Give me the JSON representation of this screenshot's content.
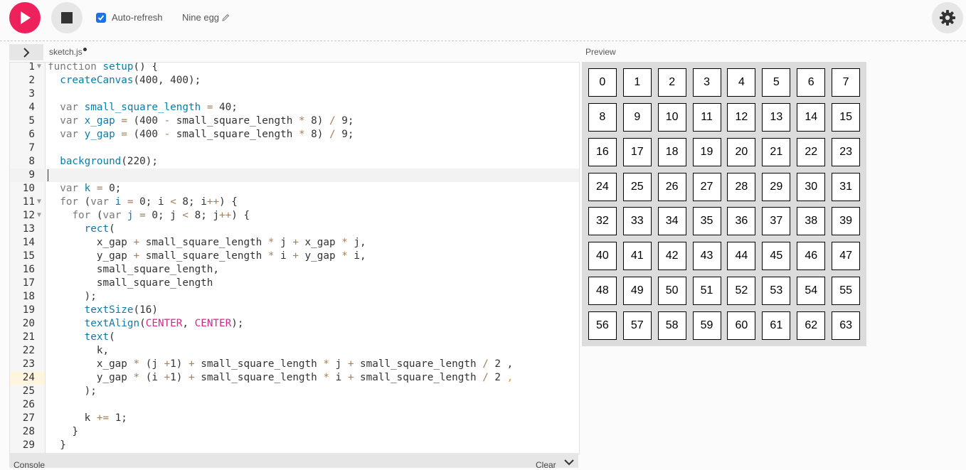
{
  "toolbar": {
    "play_icon": "play-icon",
    "stop_icon": "stop-icon",
    "auto_refresh_label": "Auto-refresh",
    "auto_refresh_checked": true,
    "project_name": "Nine egg",
    "edit_icon": "pencil-icon",
    "settings_icon": "gear-icon",
    "accent_color": "#ed225d"
  },
  "editor": {
    "file_name": "sketch.js",
    "unsaved": true,
    "active_line": 9,
    "lines": [
      {
        "n": "1",
        "fold": true,
        "tokens": [
          [
            "kw",
            "function"
          ],
          [
            "t",
            " "
          ],
          [
            "fn",
            "setup"
          ],
          [
            "t",
            "() {"
          ]
        ]
      },
      {
        "n": "2",
        "tokens": [
          [
            "t",
            "  "
          ],
          [
            "fn",
            "createCanvas"
          ],
          [
            "t",
            "(400, 400);"
          ]
        ]
      },
      {
        "n": "3",
        "tokens": []
      },
      {
        "n": "4",
        "tokens": [
          [
            "t",
            "  "
          ],
          [
            "kw",
            "var"
          ],
          [
            "t",
            " "
          ],
          [
            "def",
            "small_square_length"
          ],
          [
            "t",
            " "
          ],
          [
            "op",
            "="
          ],
          [
            "t",
            " 40;"
          ]
        ]
      },
      {
        "n": "5",
        "tokens": [
          [
            "t",
            "  "
          ],
          [
            "kw",
            "var"
          ],
          [
            "t",
            " "
          ],
          [
            "def",
            "x_gap"
          ],
          [
            "t",
            " "
          ],
          [
            "op",
            "="
          ],
          [
            "t",
            " (400 "
          ],
          [
            "op",
            "-"
          ],
          [
            "t",
            " small_square_length "
          ],
          [
            "op",
            "*"
          ],
          [
            "t",
            " 8) "
          ],
          [
            "op",
            "/"
          ],
          [
            "t",
            " 9;"
          ]
        ]
      },
      {
        "n": "6",
        "tokens": [
          [
            "t",
            "  "
          ],
          [
            "kw",
            "var"
          ],
          [
            "t",
            " "
          ],
          [
            "def",
            "y_gap"
          ],
          [
            "t",
            " "
          ],
          [
            "op",
            "="
          ],
          [
            "t",
            " (400 "
          ],
          [
            "op",
            "-"
          ],
          [
            "t",
            " small_square_length "
          ],
          [
            "op",
            "*"
          ],
          [
            "t",
            " 8) "
          ],
          [
            "op",
            "/"
          ],
          [
            "t",
            " 9;"
          ]
        ]
      },
      {
        "n": "7",
        "tokens": []
      },
      {
        "n": "8",
        "tokens": [
          [
            "t",
            "  "
          ],
          [
            "fn",
            "background"
          ],
          [
            "t",
            "(220);"
          ]
        ]
      },
      {
        "n": "9",
        "tokens": []
      },
      {
        "n": "10",
        "tokens": [
          [
            "t",
            "  "
          ],
          [
            "kw",
            "var"
          ],
          [
            "t",
            " "
          ],
          [
            "def",
            "k"
          ],
          [
            "t",
            " "
          ],
          [
            "op",
            "="
          ],
          [
            "t",
            " 0;"
          ]
        ]
      },
      {
        "n": "11",
        "fold": true,
        "tokens": [
          [
            "t",
            "  "
          ],
          [
            "kw",
            "for"
          ],
          [
            "t",
            " ("
          ],
          [
            "kw",
            "var"
          ],
          [
            "t",
            " "
          ],
          [
            "def",
            "i"
          ],
          [
            "t",
            " "
          ],
          [
            "op",
            "="
          ],
          [
            "t",
            " 0; i "
          ],
          [
            "op",
            "<"
          ],
          [
            "t",
            " 8; i"
          ],
          [
            "op",
            "++"
          ],
          [
            "t",
            ") {"
          ]
        ]
      },
      {
        "n": "12",
        "fold": true,
        "tokens": [
          [
            "t",
            "    "
          ],
          [
            "kw",
            "for"
          ],
          [
            "t",
            " ("
          ],
          [
            "kw",
            "var"
          ],
          [
            "t",
            " "
          ],
          [
            "def",
            "j"
          ],
          [
            "t",
            " "
          ],
          [
            "op",
            "="
          ],
          [
            "t",
            " 0; j "
          ],
          [
            "op",
            "<"
          ],
          [
            "t",
            " 8; j"
          ],
          [
            "op",
            "++"
          ],
          [
            "t",
            ") {"
          ]
        ]
      },
      {
        "n": "13",
        "tokens": [
          [
            "t",
            "      "
          ],
          [
            "fn",
            "rect"
          ],
          [
            "t",
            "("
          ]
        ]
      },
      {
        "n": "14",
        "tokens": [
          [
            "t",
            "        x_gap "
          ],
          [
            "op",
            "+"
          ],
          [
            "t",
            " small_square_length "
          ],
          [
            "op",
            "*"
          ],
          [
            "t",
            " j "
          ],
          [
            "op",
            "+"
          ],
          [
            "t",
            " x_gap "
          ],
          [
            "op",
            "*"
          ],
          [
            "t",
            " j,"
          ]
        ]
      },
      {
        "n": "15",
        "tokens": [
          [
            "t",
            "        y_gap "
          ],
          [
            "op",
            "+"
          ],
          [
            "t",
            " small_square_length "
          ],
          [
            "op",
            "*"
          ],
          [
            "t",
            " i "
          ],
          [
            "op",
            "+"
          ],
          [
            "t",
            " y_gap "
          ],
          [
            "op",
            "*"
          ],
          [
            "t",
            " i,"
          ]
        ]
      },
      {
        "n": "16",
        "tokens": [
          [
            "t",
            "        small_square_length,"
          ]
        ]
      },
      {
        "n": "17",
        "tokens": [
          [
            "t",
            "        small_square_length"
          ]
        ]
      },
      {
        "n": "18",
        "tokens": [
          [
            "t",
            "      );"
          ]
        ]
      },
      {
        "n": "19",
        "tokens": [
          [
            "t",
            "      "
          ],
          [
            "fn",
            "textSize"
          ],
          [
            "t",
            "(16)"
          ]
        ]
      },
      {
        "n": "20",
        "tokens": [
          [
            "t",
            "      "
          ],
          [
            "fn",
            "textAlign"
          ],
          [
            "t",
            "("
          ],
          [
            "const",
            "CENTER"
          ],
          [
            "t",
            ", "
          ],
          [
            "const",
            "CENTER"
          ],
          [
            "t",
            ");"
          ]
        ]
      },
      {
        "n": "21",
        "tokens": [
          [
            "t",
            "      "
          ],
          [
            "fn",
            "text"
          ],
          [
            "t",
            "("
          ]
        ]
      },
      {
        "n": "22",
        "tokens": [
          [
            "t",
            "        k,"
          ]
        ]
      },
      {
        "n": "23",
        "tokens": [
          [
            "t",
            "        x_gap "
          ],
          [
            "op",
            "*"
          ],
          [
            "t",
            " (j "
          ],
          [
            "op",
            "+"
          ],
          [
            "t",
            "1) "
          ],
          [
            "op",
            "+"
          ],
          [
            "t",
            " small_square_length "
          ],
          [
            "op",
            "*"
          ],
          [
            "t",
            " j "
          ],
          [
            "op",
            "+"
          ],
          [
            "t",
            " small_square_length "
          ],
          [
            "op",
            "/"
          ],
          [
            "t",
            " 2 ,"
          ]
        ]
      },
      {
        "n": "24",
        "tokens": [
          [
            "t",
            "        y_gap "
          ],
          [
            "op",
            "*"
          ],
          [
            "t",
            " (i "
          ],
          [
            "op",
            "+"
          ],
          [
            "t",
            "1) "
          ],
          [
            "op",
            "+"
          ],
          [
            "t",
            " small_square_length "
          ],
          [
            "op",
            "*"
          ],
          [
            "t",
            " i "
          ],
          [
            "op",
            "+"
          ],
          [
            "t",
            " small_square_length "
          ],
          [
            "op",
            "/"
          ],
          [
            "t",
            " 2 "
          ],
          [
            "warn",
            ","
          ]
        ]
      },
      {
        "n": "25",
        "tokens": [
          [
            "t",
            "      );"
          ]
        ]
      },
      {
        "n": "26",
        "tokens": []
      },
      {
        "n": "27",
        "tokens": [
          [
            "t",
            "      k "
          ],
          [
            "op",
            "+="
          ],
          [
            "t",
            " 1;"
          ]
        ]
      },
      {
        "n": "28",
        "tokens": [
          [
            "t",
            "    }"
          ]
        ]
      },
      {
        "n": "29",
        "tokens": [
          [
            "t",
            "  }"
          ]
        ]
      }
    ],
    "colors": {
      "kw": "#7a7a7a",
      "fn": "#0b7ca9",
      "def": "#0b7ca9",
      "op": "#a67f59",
      "const": "#d52889",
      "t": "#333333",
      "warn": "#e09c2b"
    }
  },
  "console": {
    "title": "Console",
    "clear_label": "Clear",
    "chevron_icon": "chevron-down-icon"
  },
  "preview": {
    "label": "Preview",
    "rows": 8,
    "cols": 8,
    "cells": [
      "0",
      "1",
      "2",
      "3",
      "4",
      "5",
      "6",
      "7",
      "8",
      "9",
      "10",
      "11",
      "12",
      "13",
      "14",
      "15",
      "16",
      "17",
      "18",
      "19",
      "20",
      "21",
      "22",
      "23",
      "24",
      "25",
      "26",
      "27",
      "28",
      "29",
      "30",
      "31",
      "32",
      "33",
      "34",
      "35",
      "36",
      "37",
      "38",
      "39",
      "40",
      "41",
      "42",
      "43",
      "44",
      "45",
      "46",
      "47",
      "48",
      "49",
      "50",
      "51",
      "52",
      "53",
      "54",
      "55",
      "56",
      "57",
      "58",
      "59",
      "60",
      "61",
      "62",
      "63"
    ],
    "background": "#dcdcdc"
  }
}
